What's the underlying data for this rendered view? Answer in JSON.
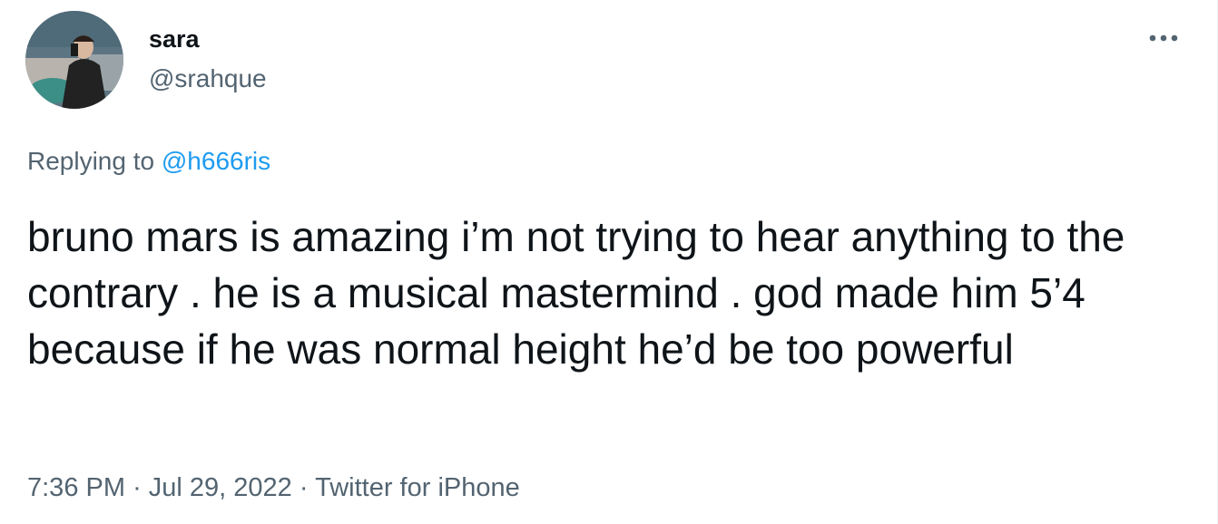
{
  "author": {
    "display_name": "sara",
    "handle": "@srahque",
    "avatar_icon": "profile-photo"
  },
  "more_icon": "more-horizontal-icon",
  "reply": {
    "prefix": "Replying to",
    "mention": "@h666ris"
  },
  "tweet_text": "bruno mars is amazing i’m not trying to hear anything to the contrary . he is a musical mastermind . god made him 5’4 because if he was normal height he’d be too powerful",
  "meta": {
    "time": "7:36 PM",
    "separator": "·",
    "date": "Jul 29, 2022",
    "source": "Twitter for iPhone"
  },
  "colors": {
    "text": "#0f1419",
    "secondary": "#536471",
    "link": "#1d9bf0"
  }
}
